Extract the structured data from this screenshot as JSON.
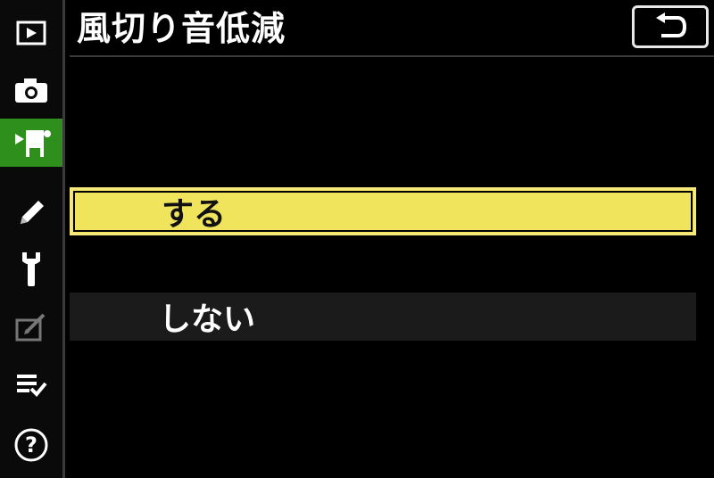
{
  "title": "風切り音低減",
  "options": [
    {
      "label": "する",
      "selected": true
    },
    {
      "label": "しない",
      "selected": false
    }
  ],
  "sidebar": {
    "items": [
      {
        "icon": "playback-icon"
      },
      {
        "icon": "camera-icon"
      },
      {
        "icon": "movie-camera-icon",
        "active": true
      },
      {
        "icon": "pencil-icon"
      },
      {
        "icon": "wrench-icon"
      },
      {
        "icon": "retouch-icon"
      },
      {
        "icon": "my-menu-icon"
      },
      {
        "icon": "help-icon"
      }
    ]
  },
  "colors": {
    "accent_green": "#2f8f1c",
    "highlight_yellow": "#f1e45d",
    "background": "#000000"
  },
  "back_button": {
    "icon": "return-arrow-icon"
  }
}
